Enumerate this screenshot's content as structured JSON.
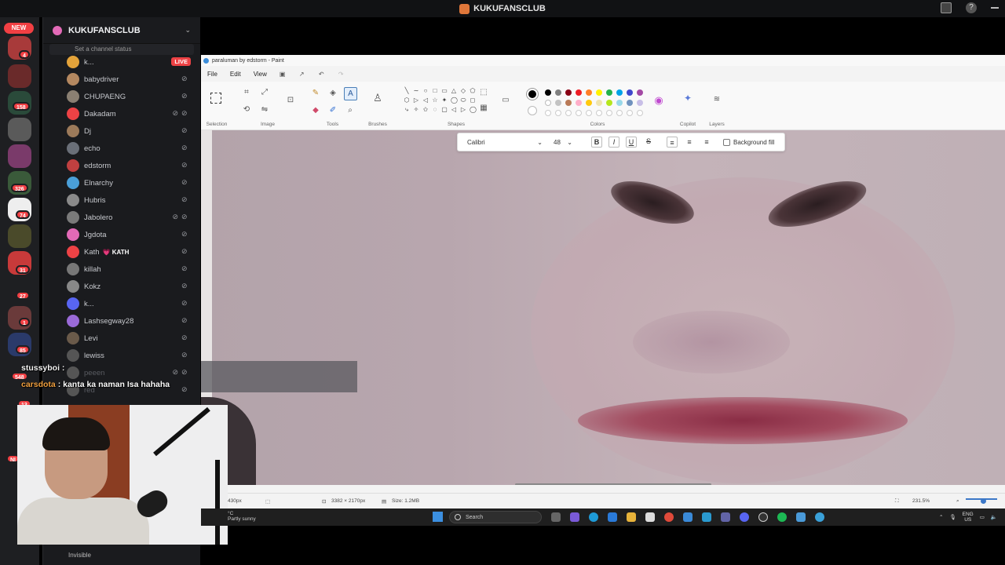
{
  "topbar": {
    "title": "KUKUFANSCLUB"
  },
  "rail": {
    "new_badge": "NEW",
    "counts": [
      "4",
      "158",
      "326",
      "74",
      "31",
      "27",
      "1",
      "85",
      "548",
      "13"
    ],
    "bottom_badge": "NI"
  },
  "panel": {
    "server_name": "KUKUFANSCLUB",
    "status_placeholder": "Set a channel status",
    "members": [
      {
        "name": "k...",
        "live": "LIVE",
        "color": "#e4a33a"
      },
      {
        "name": "babydriver",
        "color": "#b48860"
      },
      {
        "name": "CHUPAENG",
        "color": "#8a7f72"
      },
      {
        "name": "Dakadam",
        "color": "#ed4245"
      },
      {
        "name": "Dj",
        "color": "#9c7a5a"
      },
      {
        "name": "echo",
        "color": "#6a6f78"
      },
      {
        "name": "edstorm",
        "color": "#c04040"
      },
      {
        "name": "Elnarchy",
        "color": "#4a9fd8"
      },
      {
        "name": "Hubris",
        "color": "#8a8a8a"
      },
      {
        "name": "Jabolero",
        "color": "#7a7a7a"
      },
      {
        "name": "Jgdota",
        "color": "#e36ab7"
      },
      {
        "name": "Kath",
        "tag": "💗 KATH",
        "color": "#ed4245"
      },
      {
        "name": "killah",
        "color": "#777"
      },
      {
        "name": "Kokz",
        "color": "#888"
      },
      {
        "name": "k...",
        "color": "#5865f2"
      },
      {
        "name": "Lashsegway28",
        "color": "#9a6ad8"
      },
      {
        "name": "Levi",
        "color": "#6a5a4a"
      },
      {
        "name": "lewiss",
        "color": "#555"
      },
      {
        "name": "peeen",
        "color": "#555"
      },
      {
        "name": "red",
        "color": "#555"
      }
    ],
    "footer_status": "Invisible"
  },
  "paint": {
    "window_title": "paraluman by edstorm - Paint",
    "menu": [
      "File",
      "Edit",
      "View"
    ],
    "ribbon_groups": [
      "Selection",
      "Image",
      "Tools",
      "Brushes",
      "Shapes",
      "Colors",
      "Copilot",
      "Layers"
    ],
    "text_toolbar": {
      "font": "Calibri",
      "size": "48",
      "bold": "B",
      "italic": "I",
      "underline": "U",
      "strike": "S",
      "background_fill": "Background fill"
    },
    "status": {
      "cursor_pos": "430px",
      "canvas_size": "3382 × 2170px",
      "file_size": "Size: 1.2MB",
      "zoom": "231.5%"
    },
    "palette_row1": [
      "#000000",
      "#7f7f7f",
      "#880015",
      "#ed1c24",
      "#ff7f27",
      "#fff200",
      "#22b14c",
      "#00a2e8",
      "#3f48cc",
      "#a349a4"
    ],
    "palette_row2": [
      "#ffffff",
      "#c3c3c3",
      "#b97a57",
      "#ffaec9",
      "#ffc90e",
      "#efe4b0",
      "#b5e61d",
      "#99d9ea",
      "#7092be",
      "#c8bfe7"
    ]
  },
  "chat": [
    {
      "user": "stussyboi",
      "text": ""
    },
    {
      "user": "carsdota",
      "text": "kanta ka naman Isa hahaha"
    }
  ],
  "taskbar": {
    "weather_temp": "°C",
    "weather_desc": "Partly sunny",
    "search": "Search",
    "lang_1": "ENG",
    "lang_2": "US"
  }
}
